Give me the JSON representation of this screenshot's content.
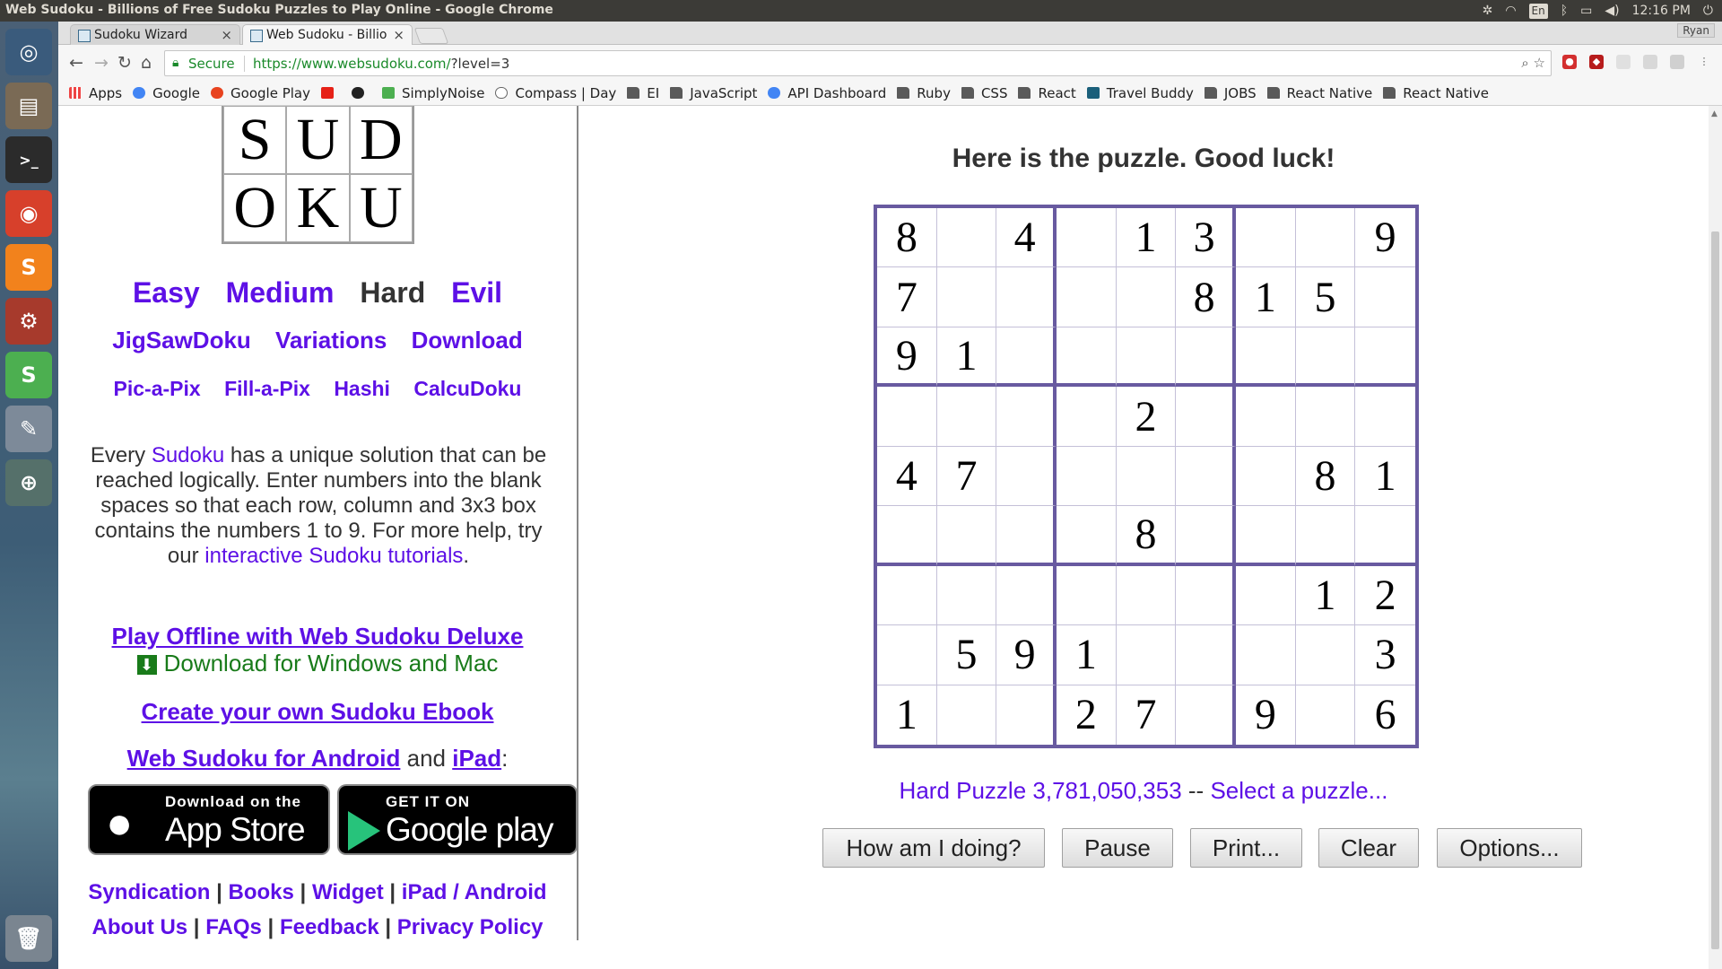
{
  "window": {
    "title": "Web Sudoku - Billions of Free Sudoku Puzzles to Play Online - Google Chrome"
  },
  "tray": {
    "lang": "En",
    "time": "12:16 PM",
    "user": "Ryan"
  },
  "tabs": [
    {
      "label": "Sudoku Wizard",
      "close": "×"
    },
    {
      "label": "Web Sudoku - Billio",
      "close": "×"
    }
  ],
  "address": {
    "secure": "Secure",
    "url_host": "https://www.websudoku.com/",
    "url_rest": "?level=3"
  },
  "bookmarks": [
    "Apps",
    "Google",
    "Google Play",
    "SimplyNoise",
    "Compass | Day",
    "EI",
    "JavaScript",
    "API Dashboard",
    "Ruby",
    "CSS",
    "React",
    "Travel Buddy",
    "JOBS",
    "React Native",
    "React Native"
  ],
  "logo": [
    "S",
    "U",
    "D",
    "O",
    "K",
    "U"
  ],
  "levels": {
    "easy": "Easy",
    "medium": "Medium",
    "hard": "Hard",
    "evil": "Evil"
  },
  "more": {
    "jigsaw": "JigSawDoku",
    "variations": "Variations",
    "download": "Download"
  },
  "puzzles": {
    "picapix": "Pic-a-Pix",
    "fillapix": "Fill-a-Pix",
    "hashi": "Hashi",
    "calcudoku": "CalcuDoku"
  },
  "description": {
    "before": "Every ",
    "link1": "Sudoku",
    "middle": " has a unique solution that can be reached logically. Enter numbers into the blank spaces so that each row, column and 3x3 box contains the numbers 1 to 9. For more help, try our ",
    "link2": "interactive Sudoku tutorials",
    "after": "."
  },
  "promo": {
    "offline": "Play Offline with Web Sudoku Deluxe",
    "download_win": "Download for Windows and Mac",
    "ebook": "Create your own Sudoku Ebook",
    "android": "Web Sudoku for Android",
    "and": " and ",
    "ipad": "iPad",
    "colon": ":"
  },
  "stores": {
    "apple_small": "Download on the",
    "apple_big": "App Store",
    "google_small": "GET IT ON",
    "google_big": "Google play"
  },
  "footer": {
    "syndication": "Syndication",
    "books": "Books",
    "widget": "Widget",
    "ipad_android": "iPad / Android",
    "about": "About Us",
    "faqs": "FAQs",
    "feedback": "Feedback",
    "privacy": "Privacy Policy",
    "sep": " | "
  },
  "main": {
    "heading": "Here is the puzzle. Good luck!"
  },
  "grid": [
    [
      "8",
      "",
      "4",
      "",
      "1",
      "3",
      "",
      "",
      "9"
    ],
    [
      "7",
      "",
      "",
      "",
      "",
      "8",
      "1",
      "5",
      ""
    ],
    [
      "9",
      "1",
      "",
      "",
      "",
      "",
      "",
      "",
      ""
    ],
    [
      "",
      "",
      "",
      "",
      "2",
      "",
      "",
      "",
      ""
    ],
    [
      "4",
      "7",
      "",
      "",
      "",
      "",
      "",
      "8",
      "1"
    ],
    [
      "",
      "",
      "",
      "",
      "8",
      "",
      "",
      "",
      ""
    ],
    [
      "",
      "",
      "",
      "",
      "",
      "",
      "",
      "1",
      "2"
    ],
    [
      "",
      "5",
      "9",
      "1",
      "",
      "",
      "",
      "",
      "3"
    ],
    [
      "1",
      "",
      "",
      "2",
      "7",
      "",
      "9",
      "",
      "6"
    ]
  ],
  "puzzle_info": {
    "label": "Hard Puzzle 3,781,050,353",
    "dash": " -- ",
    "select": "Select a puzzle..."
  },
  "buttons": {
    "how": "How am I doing?",
    "pause": "Pause",
    "print": "Print...",
    "clear": "Clear",
    "options": "Options..."
  }
}
